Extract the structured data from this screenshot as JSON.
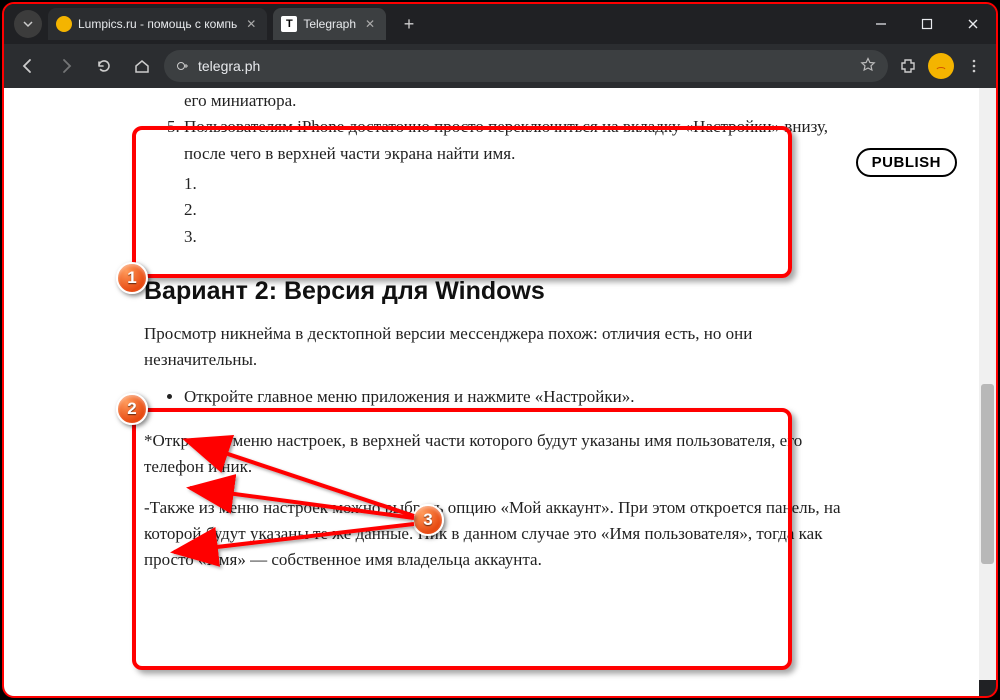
{
  "window": {
    "tabs": [
      {
        "title": "Lumpics.ru - помощь с компь",
        "favicon_color": "#f4b400"
      },
      {
        "title": "Telegraph",
        "favicon_letter": "T"
      }
    ],
    "url": "telegra.ph",
    "minimize": "–",
    "maximize": "▢",
    "close": "✕"
  },
  "publish_label": "PUBLISH",
  "article": {
    "thumb_fragment": "его миниатюра.",
    "ol_start": 5,
    "item5_text": "Пользователям iPhone достаточно просто переключиться на вкладку «Настройки» внизу, после чего в верхней части экрана найти имя.",
    "sub": [
      "1.",
      "2.",
      "3."
    ],
    "heading2": "Вариант 2: Версия для Windows",
    "desc2": "Просмотр никнейма в десктопной версии мессенджера похож: отличия есть, но они незначительны.",
    "bullet": "Откройте главное меню приложения и нажмите «Настройки».",
    "star_para": "*Откроется меню настроек, в верхней части которого будут указаны имя пользователя, его телефон и ник.",
    "dash_para": "-Также из меню настроек можно выбрать опцию «Мой аккаунт». При этом откроется панель, на которой будут указаны те же данные. Ник в данном случае это «Имя пользователя», тогда как просто «Имя» — собственное имя владельца аккаунта."
  },
  "badges": {
    "b1": "1",
    "b2": "2",
    "b3": "3"
  },
  "colors": {
    "annotation": "#ff0000",
    "badge": "#e74a12"
  }
}
